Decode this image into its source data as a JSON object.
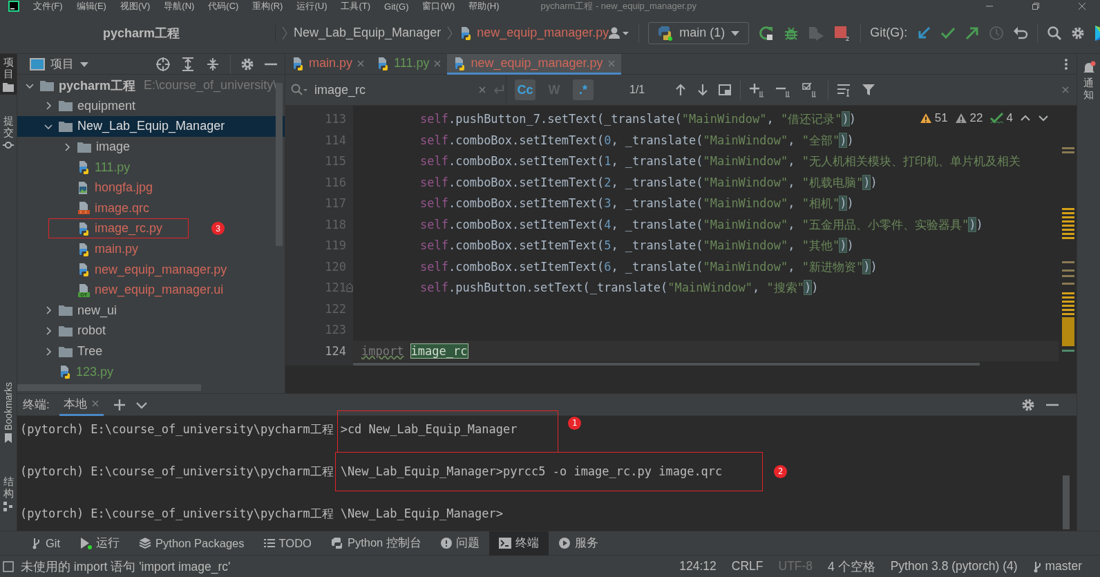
{
  "menu": [
    "文件(F)",
    "编辑(E)",
    "视图(V)",
    "导航(N)",
    "代码(C)",
    "重构(R)",
    "运行(U)",
    "工具(T)",
    "Git(G)",
    "窗口(W)",
    "帮助(H)"
  ],
  "window_title": "pycharm工程 - new_equip_manager.py",
  "breadcrumbs": [
    {
      "label": "pycharm工程",
      "kind": "project"
    },
    {
      "label": "New_Lab_Equip_Manager",
      "kind": "folder"
    },
    {
      "label": "new_equip_manager.py",
      "kind": "file"
    }
  ],
  "run_config": "main (1)",
  "stop_count": "2",
  "git_label": "Git(G):",
  "left_stripe": {
    "top": [
      {
        "label": "项目",
        "selected": true
      },
      {
        "label": "提交",
        "selected": false
      }
    ],
    "bottom": [
      {
        "label": "Bookmarks",
        "selected": false
      },
      {
        "label": "结构",
        "selected": false
      }
    ]
  },
  "right_stripe": [
    {
      "label": "通知",
      "unread": true
    }
  ],
  "project_panel": {
    "title": "项目",
    "tree": [
      {
        "name": "pycharm工程",
        "path": "E:\\course_of_university\\",
        "kind": "folder",
        "color": "#bbbbbb",
        "expanded": true,
        "selected": false,
        "children": [
          {
            "name": "equipment",
            "kind": "folder",
            "color": "#bbbbbb",
            "expanded": false,
            "selected": false
          },
          {
            "name": "New_Lab_Equip_Manager",
            "kind": "folder",
            "color": "#dddddd",
            "expanded": true,
            "selected": true,
            "children": [
              {
                "name": "image",
                "kind": "folder",
                "color": "#bbbbbb",
                "expanded": false,
                "selected": false
              },
              {
                "name": "111.py",
                "kind": "py",
                "color": "#629755",
                "selected": false
              },
              {
                "name": "hongfa.jpg",
                "kind": "jpg",
                "color": "#d1675a",
                "selected": false
              },
              {
                "name": "image.qrc",
                "kind": "qrc",
                "color": "#d1675a",
                "selected": false
              },
              {
                "name": "image_rc.py",
                "kind": "py",
                "color": "#d1675a",
                "selected": false,
                "annotation": "3"
              },
              {
                "name": "main.py",
                "kind": "py",
                "color": "#d1675a",
                "selected": false
              },
              {
                "name": "new_equip_manager.py",
                "kind": "py",
                "color": "#d1675a",
                "selected": false
              },
              {
                "name": "new_equip_manager.ui",
                "kind": "ui",
                "color": "#d1675a",
                "selected": false
              }
            ]
          },
          {
            "name": "new_ui",
            "kind": "folder",
            "color": "#bbbbbb",
            "expanded": false,
            "selected": false
          },
          {
            "name": "robot",
            "kind": "folder",
            "color": "#bbbbbb",
            "expanded": false,
            "selected": false
          },
          {
            "name": "Tree",
            "kind": "folder",
            "color": "#bbbbbb",
            "expanded": false,
            "selected": false
          },
          {
            "name": "123.py",
            "kind": "py",
            "color": "#629755",
            "selected": false
          }
        ]
      }
    ]
  },
  "editor": {
    "tabs": [
      {
        "label": "main.py",
        "color": "#d1675a",
        "selected": false
      },
      {
        "label": "111.py",
        "color": "#629755",
        "selected": false
      },
      {
        "label": "new_equip_manager.py",
        "color": "#d1675a",
        "selected": true
      }
    ],
    "find": {
      "query": "image_rc",
      "options": [
        {
          "label": "Cc",
          "selected": true
        },
        {
          "label": "W",
          "selected": false
        },
        {
          "label": ".*",
          "selected": true
        }
      ],
      "count": "1/1"
    },
    "inspections": [
      {
        "kind": "warning",
        "count": "51"
      },
      {
        "kind": "weak_warning",
        "count": "22"
      },
      {
        "kind": "typo",
        "count": "4"
      }
    ],
    "lines": [
      {
        "number": "113",
        "indented": true,
        "current": false,
        "tokens": [
          {
            "text": "self",
            "kind": "self"
          },
          {
            "text": ".pushButton_7.setText(_translate(",
            "kind": "plain"
          },
          {
            "text": "\"MainWindow\"",
            "kind": "str"
          },
          {
            "text": ", ",
            "kind": "plain"
          },
          {
            "text": "\"借还记录\"",
            "kind": "str"
          },
          {
            "text": ")",
            "kind": "brace"
          },
          {
            "text": ")",
            "kind": "plain"
          }
        ]
      },
      {
        "number": "114",
        "indented": true,
        "current": false,
        "tokens": [
          {
            "text": "self",
            "kind": "self"
          },
          {
            "text": ".comboBox.setItemText(",
            "kind": "plain"
          },
          {
            "text": "0",
            "kind": "num"
          },
          {
            "text": ", _translate(",
            "kind": "plain"
          },
          {
            "text": "\"MainWindow\"",
            "kind": "str"
          },
          {
            "text": ", ",
            "kind": "plain"
          },
          {
            "text": "\"全部\"",
            "kind": "str"
          },
          {
            "text": ")",
            "kind": "brace"
          },
          {
            "text": ")",
            "kind": "plain"
          }
        ]
      },
      {
        "number": "115",
        "indented": true,
        "current": false,
        "tokens": [
          {
            "text": "self",
            "kind": "self"
          },
          {
            "text": ".comboBox.setItemText(",
            "kind": "plain"
          },
          {
            "text": "1",
            "kind": "num"
          },
          {
            "text": ", _translate(",
            "kind": "plain"
          },
          {
            "text": "\"MainWindow\"",
            "kind": "str"
          },
          {
            "text": ", ",
            "kind": "plain"
          },
          {
            "text": "\"无人机相关模块、打印机、单片机及相关",
            "kind": "str"
          }
        ]
      },
      {
        "number": "116",
        "indented": true,
        "current": false,
        "tokens": [
          {
            "text": "self",
            "kind": "self"
          },
          {
            "text": ".comboBox.setItemText(",
            "kind": "plain"
          },
          {
            "text": "2",
            "kind": "num"
          },
          {
            "text": ", _translate(",
            "kind": "plain"
          },
          {
            "text": "\"MainWindow\"",
            "kind": "str"
          },
          {
            "text": ", ",
            "kind": "plain"
          },
          {
            "text": "\"机载电脑\"",
            "kind": "str"
          },
          {
            "text": ")",
            "kind": "brace"
          },
          {
            "text": ")",
            "kind": "plain"
          }
        ]
      },
      {
        "number": "117",
        "indented": true,
        "current": false,
        "tokens": [
          {
            "text": "self",
            "kind": "self"
          },
          {
            "text": ".comboBox.setItemText(",
            "kind": "plain"
          },
          {
            "text": "3",
            "kind": "num"
          },
          {
            "text": ", _translate(",
            "kind": "plain"
          },
          {
            "text": "\"MainWindow\"",
            "kind": "str"
          },
          {
            "text": ", ",
            "kind": "plain"
          },
          {
            "text": "\"相机\"",
            "kind": "str"
          },
          {
            "text": ")",
            "kind": "brace"
          },
          {
            "text": ")",
            "kind": "plain"
          }
        ]
      },
      {
        "number": "118",
        "indented": true,
        "current": false,
        "tokens": [
          {
            "text": "self",
            "kind": "self"
          },
          {
            "text": ".comboBox.setItemText(",
            "kind": "plain"
          },
          {
            "text": "4",
            "kind": "num"
          },
          {
            "text": ", _translate(",
            "kind": "plain"
          },
          {
            "text": "\"MainWindow\"",
            "kind": "str"
          },
          {
            "text": ", ",
            "kind": "plain"
          },
          {
            "text": "\"五金用品、小零件、实验器具\"",
            "kind": "str"
          },
          {
            "text": ")",
            "kind": "brace"
          },
          {
            "text": ")",
            "kind": "plain"
          }
        ]
      },
      {
        "number": "119",
        "indented": true,
        "current": false,
        "tokens": [
          {
            "text": "self",
            "kind": "self"
          },
          {
            "text": ".comboBox.setItemText(",
            "kind": "plain"
          },
          {
            "text": "5",
            "kind": "num"
          },
          {
            "text": ", _translate(",
            "kind": "plain"
          },
          {
            "text": "\"MainWindow\"",
            "kind": "str"
          },
          {
            "text": ", ",
            "kind": "plain"
          },
          {
            "text": "\"其他\"",
            "kind": "str"
          },
          {
            "text": ")",
            "kind": "brace"
          },
          {
            "text": ")",
            "kind": "plain"
          }
        ]
      },
      {
        "number": "120",
        "indented": true,
        "current": false,
        "tokens": [
          {
            "text": "self",
            "kind": "self"
          },
          {
            "text": ".comboBox.setItemText(",
            "kind": "plain"
          },
          {
            "text": "6",
            "kind": "num"
          },
          {
            "text": ", _translate(",
            "kind": "plain"
          },
          {
            "text": "\"MainWindow\"",
            "kind": "str"
          },
          {
            "text": ", ",
            "kind": "plain"
          },
          {
            "text": "\"新进物资\"",
            "kind": "str"
          },
          {
            "text": ")",
            "kind": "brace"
          },
          {
            "text": ")",
            "kind": "plain"
          }
        ]
      },
      {
        "number": "121",
        "indented": true,
        "current": false,
        "tokens": [
          {
            "text": "self",
            "kind": "self"
          },
          {
            "text": ".pushButton.setText(_translate(",
            "kind": "plain"
          },
          {
            "text": "\"MainWindow\"",
            "kind": "str"
          },
          {
            "text": ", ",
            "kind": "plain"
          },
          {
            "text": "\"搜索\"",
            "kind": "str"
          },
          {
            "text": ")",
            "kind": "brace"
          },
          {
            "text": ")",
            "kind": "plain"
          }
        ]
      },
      {
        "number": "122",
        "current": false
      },
      {
        "number": "123",
        "current": false
      },
      {
        "number": "124",
        "indented": false,
        "current": true,
        "tokens": [
          {
            "text": "import",
            "kind": "unused"
          },
          {
            "text": "image_rc",
            "kind": "match"
          }
        ]
      }
    ]
  },
  "terminal": {
    "title": "终端:",
    "tabs": [
      {
        "label": "本地",
        "selected": true
      }
    ],
    "lines": [
      {
        "prompt": "(pytorch) E:\\course_of_university\\pycharm工程",
        "command": ">cd New_Lab_Equip_Manager",
        "annotation": "1"
      },
      {
        "prompt": "(pytorch) E:\\course_of_university\\pycharm工程",
        "command": "\\New_Lab_Equip_Manager>pyrcc5 -o image_rc.py image.qrc",
        "annotation": "2"
      },
      {
        "prompt": "(pytorch) E:\\course_of_university\\pycharm工程",
        "command": "\\New_Lab_Equip_Manager>"
      }
    ]
  },
  "tool_windows": [
    {
      "label": "Git",
      "kind": "git",
      "selected": false
    },
    {
      "label": "运行",
      "kind": "run",
      "selected": false
    },
    {
      "label": "Python Packages",
      "kind": "packages",
      "selected": false
    },
    {
      "label": "TODO",
      "kind": "todo",
      "selected": false
    },
    {
      "label": "Python 控制台",
      "kind": "console",
      "selected": false
    },
    {
      "label": "问题",
      "kind": "problems",
      "selected": false
    },
    {
      "label": "终端",
      "kind": "terminal",
      "selected": true
    },
    {
      "label": "服务",
      "kind": "services",
      "selected": false
    }
  ],
  "status_bar": {
    "message": "未使用的 import 语句 'import image_rc'",
    "items": [
      {
        "label": "124:12",
        "disabled": false
      },
      {
        "label": "CRLF",
        "disabled": false
      },
      {
        "label": "UTF-8",
        "disabled": true
      },
      {
        "label": "4 个空格",
        "disabled": false
      },
      {
        "label": "Python 3.8 (pytorch) (4)",
        "disabled": false
      }
    ],
    "branch": "master"
  }
}
